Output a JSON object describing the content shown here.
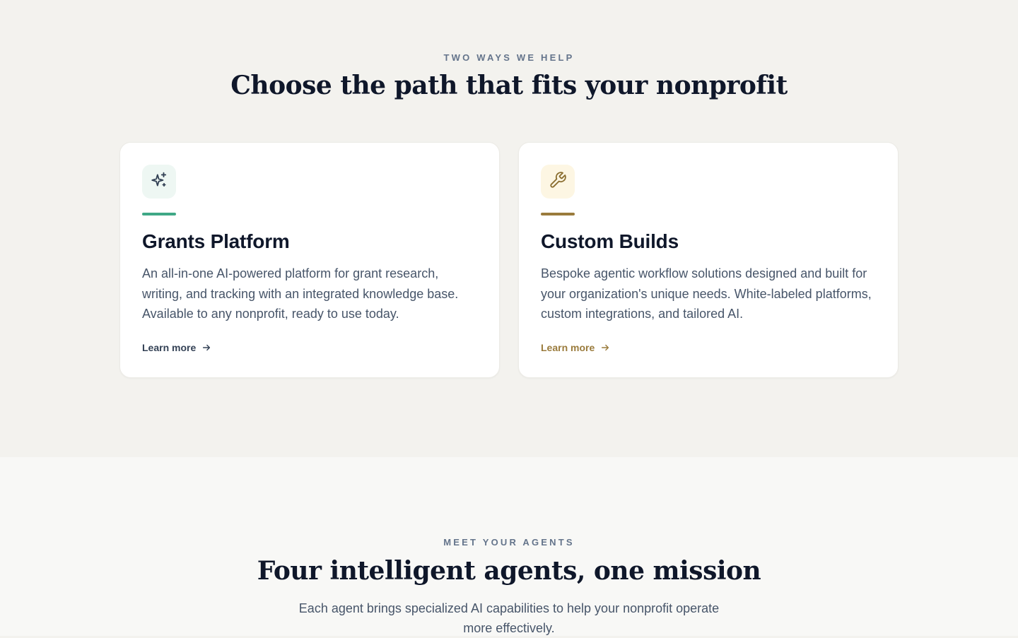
{
  "paths_section": {
    "eyebrow": "TWO WAYS WE HELP",
    "heading": "Choose the path that fits your nonprofit",
    "cards": [
      {
        "icon": "sparkles-icon",
        "accent_color": "#3fa886",
        "icon_bg": "#eef7f3",
        "title": "Grants Platform",
        "description": "An all-in-one AI-powered platform for grant research, writing, and tracking with an integrated knowledge base. Available to any nonprofit, ready to use today.",
        "link_label": "Learn more",
        "link_color": "#334155"
      },
      {
        "icon": "wrench-icon",
        "accent_color": "#9a7b3c",
        "icon_bg": "#fdf6e3",
        "title": "Custom Builds",
        "description": "Bespoke agentic workflow solutions designed and built for your organization's unique needs. White-labeled platforms, custom integrations, and tailored AI.",
        "link_label": "Learn more",
        "link_color": "#9a7b3c"
      }
    ]
  },
  "agents_section": {
    "eyebrow": "MEET YOUR AGENTS",
    "heading": "Four intelligent agents, one mission",
    "subtext": "Each agent brings specialized AI capabilities to help your nonprofit operate more effectively."
  }
}
